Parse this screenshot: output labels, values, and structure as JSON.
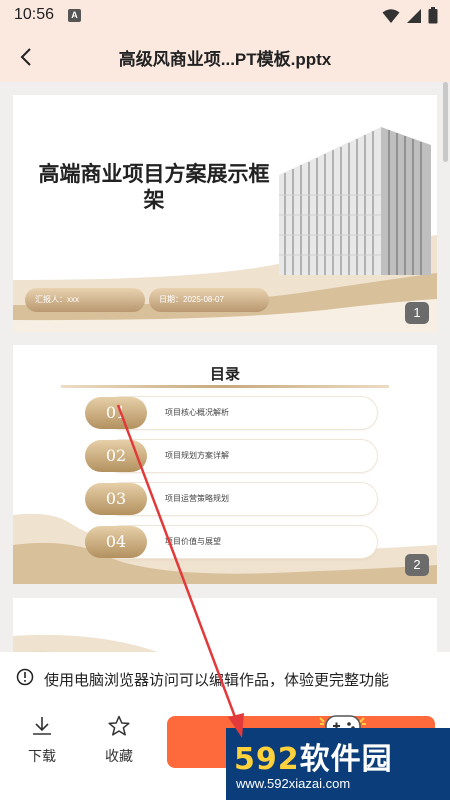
{
  "status_bar": {
    "time": "10:56",
    "badge": "A"
  },
  "header": {
    "title": "高级风商业项...PT模板.pptx"
  },
  "slides": [
    {
      "number": "1",
      "title": "高端商业项目方案展示框架",
      "reporter": "汇报人：xxx",
      "date": "日期：2025-08-07"
    },
    {
      "number": "2",
      "title": "目录",
      "items": [
        {
          "num": "01",
          "text": "项目核心概况解析"
        },
        {
          "num": "02",
          "text": "项目规划方案详解"
        },
        {
          "num": "03",
          "text": "项目运营策略规划"
        },
        {
          "num": "04",
          "text": "项目价值与展望"
        }
      ]
    }
  ],
  "notice": {
    "text": "使用电脑浏览器访问可以编辑作品，体验更完整功能"
  },
  "bottom": {
    "download_label": "下载",
    "favorite_label": "收藏"
  },
  "watermark": {
    "brand_592": "592",
    "brand_cn": "软件园",
    "url": "www.592xiazai.com"
  },
  "colors": {
    "accent": "#ff6a3d",
    "gold": "#c7a97d",
    "header_bg": "#fbe9e0",
    "watermark_bg": "#0b3d7a",
    "arrow": "#e23a3a"
  }
}
